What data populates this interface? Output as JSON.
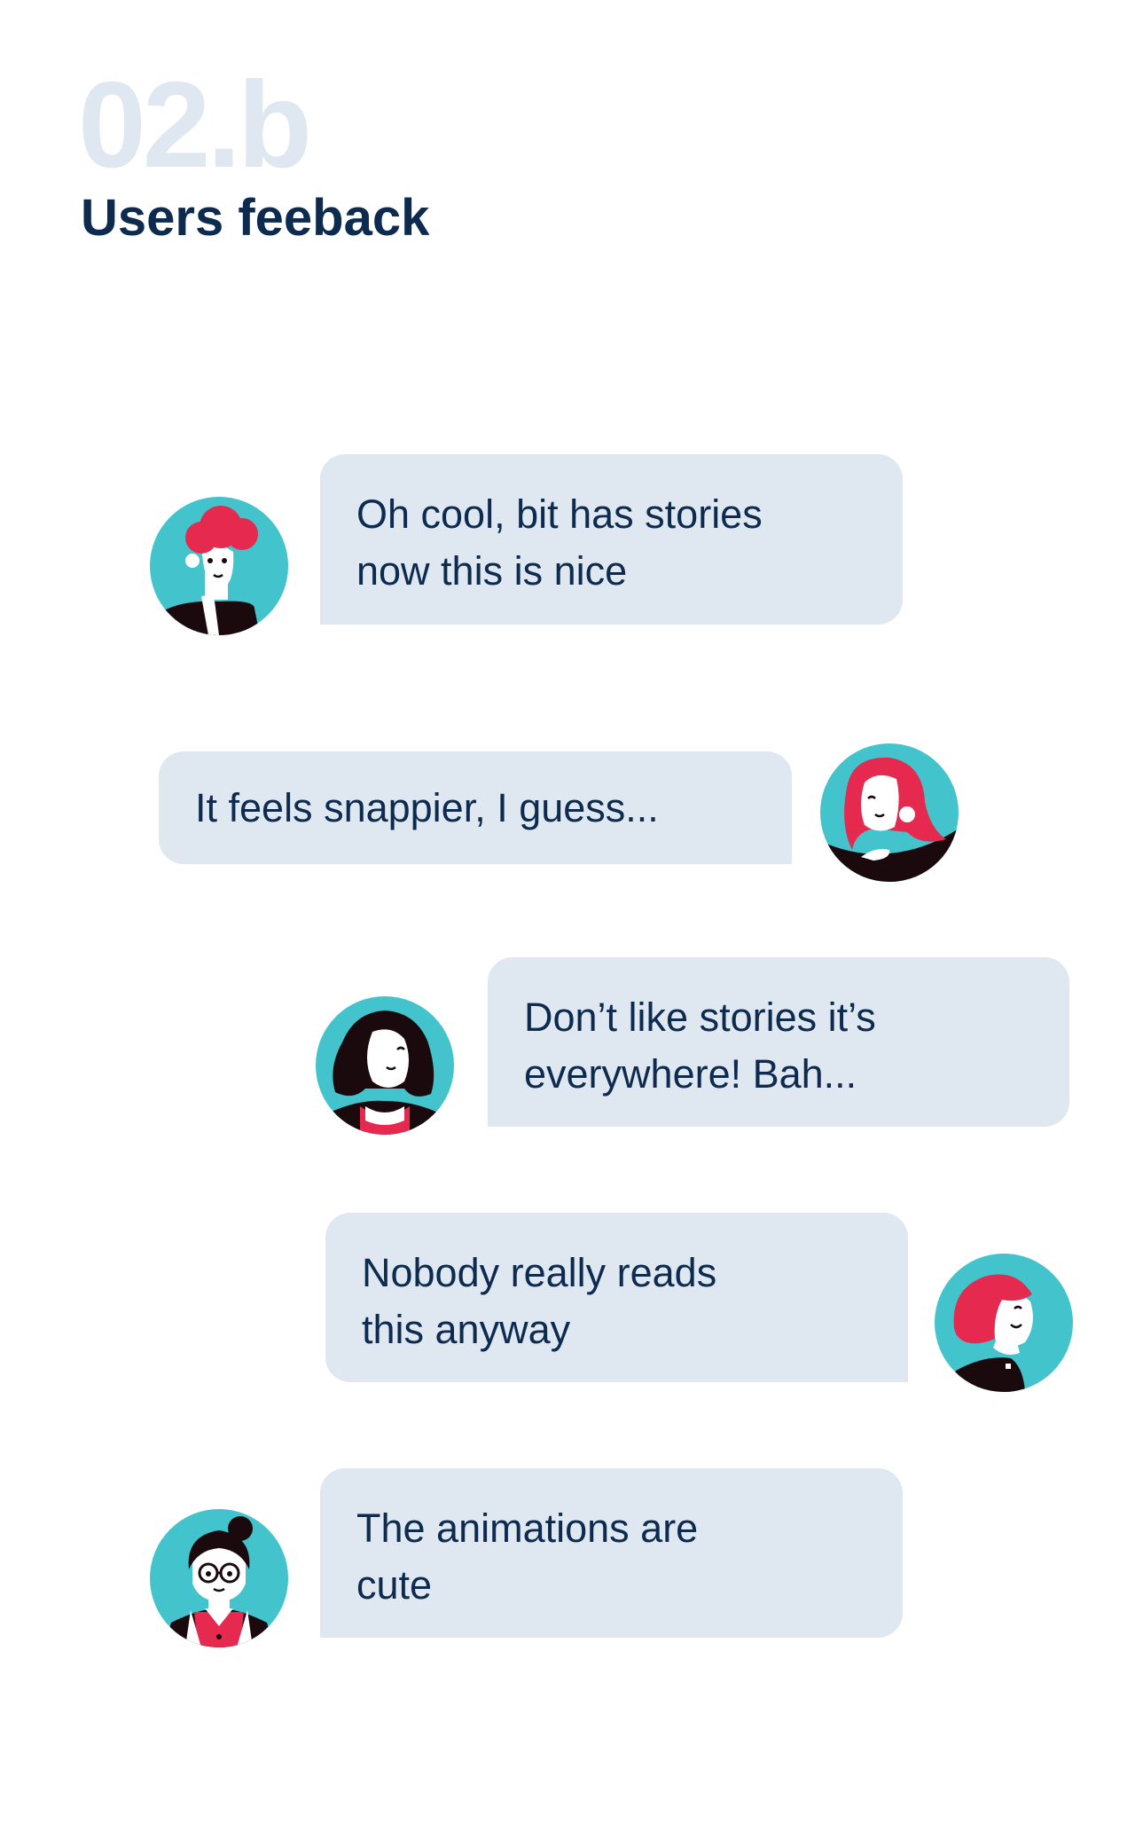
{
  "header": {
    "number": "02.b",
    "title": "Users feeback"
  },
  "messages": [
    {
      "avatar_icon": "user-avatar-1-icon",
      "lines": [
        "Oh cool, bit has stories",
        "now this is nice"
      ]
    },
    {
      "avatar_icon": "user-avatar-2-icon",
      "lines": [
        "It feels snappier, I guess..."
      ]
    },
    {
      "avatar_icon": "user-avatar-3-icon",
      "lines": [
        "Don’t like stories it’s",
        "everywhere! Bah..."
      ]
    },
    {
      "avatar_icon": "user-avatar-4-icon",
      "lines": [
        "Nobody really reads",
        "this anyway"
      ]
    },
    {
      "avatar_icon": "user-avatar-5-icon",
      "lines": [
        "The animations are",
        "cute"
      ]
    }
  ],
  "colors": {
    "bubble": "#dfe7f1",
    "text": "#0d2a4f",
    "avatar_bg": "#43c3cc",
    "hair_red": "#e5294f",
    "dark": "#1a0a0e"
  }
}
